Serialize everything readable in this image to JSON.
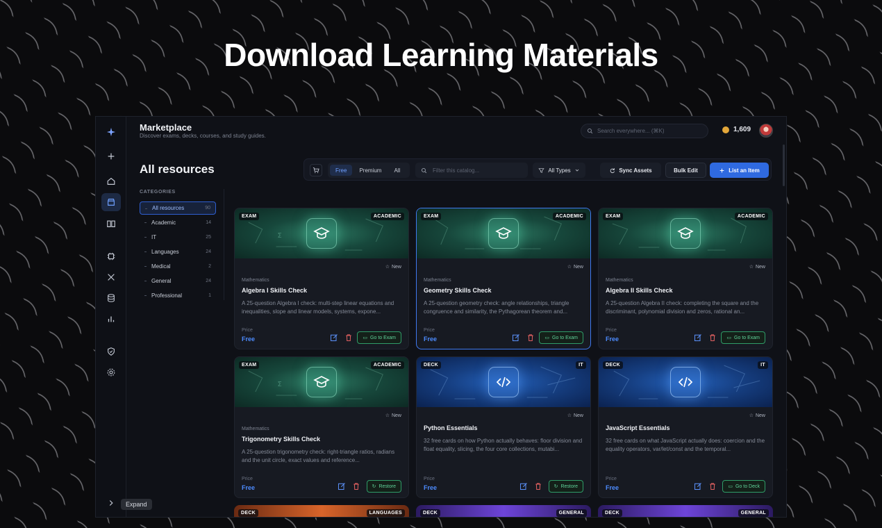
{
  "hero": {
    "title": "Download Learning Materials"
  },
  "header": {
    "title": "Marketplace",
    "subtitle": "Discover exams, decks, courses, and study guides.",
    "search_placeholder": "Search everywhere... (⌘K)",
    "coins": "1,609"
  },
  "rail": {
    "expand_label": "Expand",
    "items": [
      "logo-icon",
      "plus-icon",
      "home-icon",
      "store-icon",
      "book-icon",
      "chip-icon",
      "tools-icon",
      "database-icon",
      "chart-icon",
      "shield-icon",
      "gear-icon"
    ]
  },
  "page": {
    "heading": "All resources",
    "categories_label": "CATEGORIES"
  },
  "categories": [
    {
      "label": "All resources",
      "count": "90"
    },
    {
      "label": "Academic",
      "count": "14"
    },
    {
      "label": "IT",
      "count": "25"
    },
    {
      "label": "Languages",
      "count": "24"
    },
    {
      "label": "Medical",
      "count": "2"
    },
    {
      "label": "General",
      "count": "24"
    },
    {
      "label": "Professional",
      "count": "1"
    }
  ],
  "toolbar": {
    "segments": [
      "Free",
      "Premium",
      "All"
    ],
    "filter_placeholder": "Filter this catalog...",
    "types_label": "All Types",
    "sync_label": "Sync Assets",
    "bulk_label": "Bulk Edit",
    "list_label": "List an Item"
  },
  "cards": [
    {
      "type": "EXAM",
      "category": "ACADEMIC",
      "new_label": "New",
      "subject": "Mathematics",
      "title": "Algebra I Skills Check",
      "desc": "A 25-question Algebra I check: multi-step linear equations and inequalities, slope and linear models, systems, expone...",
      "price_label": "Price",
      "price": "Free",
      "action": "Go to Exam"
    },
    {
      "type": "EXAM",
      "category": "ACADEMIC",
      "new_label": "New",
      "subject": "Mathematics",
      "title": "Geometry Skills Check",
      "desc": "A 25-question geometry check: angle relationships, triangle congruence and similarity, the Pythagorean theorem and...",
      "price_label": "Price",
      "price": "Free",
      "action": "Go to Exam"
    },
    {
      "type": "EXAM",
      "category": "ACADEMIC",
      "new_label": "New",
      "subject": "Mathematics",
      "title": "Algebra II Skills Check",
      "desc": "A 25-question Algebra II check: completing the square and the discriminant, polynomial division and zeros, rational an...",
      "price_label": "Price",
      "price": "Free",
      "action": "Go to Exam"
    },
    {
      "type": "EXAM",
      "category": "ACADEMIC",
      "new_label": "New",
      "subject": "Mathematics",
      "title": "Trigonometry Skills Check",
      "desc": "A 25-question trigonometry check: right-triangle ratios, radians and the unit circle, exact values and reference...",
      "price_label": "Price",
      "price": "Free",
      "action": "Restore"
    },
    {
      "type": "DECK",
      "category": "IT",
      "new_label": "New",
      "subject": "",
      "title": "Python Essentials",
      "desc": "32 free cards on how Python actually behaves: floor division and float equality, slicing, the four core collections, mutabi...",
      "price_label": "Price",
      "price": "Free",
      "action": "Restore"
    },
    {
      "type": "DECK",
      "category": "IT",
      "new_label": "New",
      "subject": "",
      "title": "JavaScript Essentials",
      "desc": "32 free cards on what JavaScript actually does: coercion and the equality operators, var/let/const and the temporal...",
      "price_label": "Price",
      "price": "Free",
      "action": "Go to Deck"
    }
  ],
  "partial_cards": [
    {
      "type": "DECK",
      "category": "LANGUAGES"
    },
    {
      "type": "DECK",
      "category": "GENERAL"
    },
    {
      "type": "DECK",
      "category": "GENERAL"
    }
  ],
  "colors": {
    "accent": "#2f6ae0",
    "free": "#4d8cff",
    "action_green": "#5fd39a",
    "background": "#0b0b0d"
  }
}
